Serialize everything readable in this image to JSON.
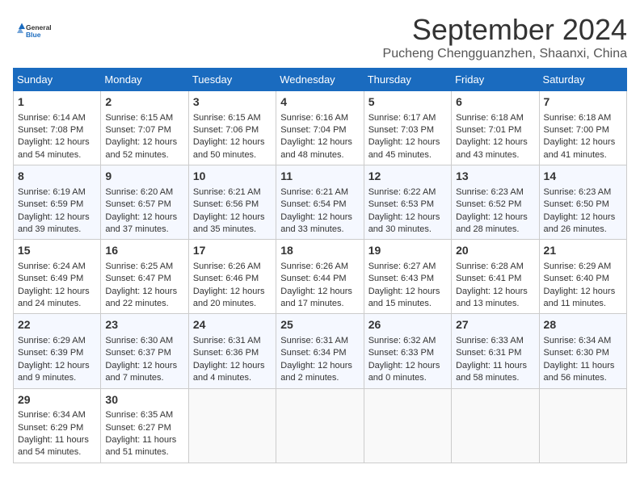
{
  "header": {
    "logo_general": "General",
    "logo_blue": "Blue",
    "month_title": "September 2024",
    "location": "Pucheng Chengguanzhen, Shaanxi, China"
  },
  "days_of_week": [
    "Sunday",
    "Monday",
    "Tuesday",
    "Wednesday",
    "Thursday",
    "Friday",
    "Saturday"
  ],
  "weeks": [
    [
      {
        "day": "1",
        "info": "Sunrise: 6:14 AM\nSunset: 7:08 PM\nDaylight: 12 hours\nand 54 minutes."
      },
      {
        "day": "2",
        "info": "Sunrise: 6:15 AM\nSunset: 7:07 PM\nDaylight: 12 hours\nand 52 minutes."
      },
      {
        "day": "3",
        "info": "Sunrise: 6:15 AM\nSunset: 7:06 PM\nDaylight: 12 hours\nand 50 minutes."
      },
      {
        "day": "4",
        "info": "Sunrise: 6:16 AM\nSunset: 7:04 PM\nDaylight: 12 hours\nand 48 minutes."
      },
      {
        "day": "5",
        "info": "Sunrise: 6:17 AM\nSunset: 7:03 PM\nDaylight: 12 hours\nand 45 minutes."
      },
      {
        "day": "6",
        "info": "Sunrise: 6:18 AM\nSunset: 7:01 PM\nDaylight: 12 hours\nand 43 minutes."
      },
      {
        "day": "7",
        "info": "Sunrise: 6:18 AM\nSunset: 7:00 PM\nDaylight: 12 hours\nand 41 minutes."
      }
    ],
    [
      {
        "day": "8",
        "info": "Sunrise: 6:19 AM\nSunset: 6:59 PM\nDaylight: 12 hours\nand 39 minutes."
      },
      {
        "day": "9",
        "info": "Sunrise: 6:20 AM\nSunset: 6:57 PM\nDaylight: 12 hours\nand 37 minutes."
      },
      {
        "day": "10",
        "info": "Sunrise: 6:21 AM\nSunset: 6:56 PM\nDaylight: 12 hours\nand 35 minutes."
      },
      {
        "day": "11",
        "info": "Sunrise: 6:21 AM\nSunset: 6:54 PM\nDaylight: 12 hours\nand 33 minutes."
      },
      {
        "day": "12",
        "info": "Sunrise: 6:22 AM\nSunset: 6:53 PM\nDaylight: 12 hours\nand 30 minutes."
      },
      {
        "day": "13",
        "info": "Sunrise: 6:23 AM\nSunset: 6:52 PM\nDaylight: 12 hours\nand 28 minutes."
      },
      {
        "day": "14",
        "info": "Sunrise: 6:23 AM\nSunset: 6:50 PM\nDaylight: 12 hours\nand 26 minutes."
      }
    ],
    [
      {
        "day": "15",
        "info": "Sunrise: 6:24 AM\nSunset: 6:49 PM\nDaylight: 12 hours\nand 24 minutes."
      },
      {
        "day": "16",
        "info": "Sunrise: 6:25 AM\nSunset: 6:47 PM\nDaylight: 12 hours\nand 22 minutes."
      },
      {
        "day": "17",
        "info": "Sunrise: 6:26 AM\nSunset: 6:46 PM\nDaylight: 12 hours\nand 20 minutes."
      },
      {
        "day": "18",
        "info": "Sunrise: 6:26 AM\nSunset: 6:44 PM\nDaylight: 12 hours\nand 17 minutes."
      },
      {
        "day": "19",
        "info": "Sunrise: 6:27 AM\nSunset: 6:43 PM\nDaylight: 12 hours\nand 15 minutes."
      },
      {
        "day": "20",
        "info": "Sunrise: 6:28 AM\nSunset: 6:41 PM\nDaylight: 12 hours\nand 13 minutes."
      },
      {
        "day": "21",
        "info": "Sunrise: 6:29 AM\nSunset: 6:40 PM\nDaylight: 12 hours\nand 11 minutes."
      }
    ],
    [
      {
        "day": "22",
        "info": "Sunrise: 6:29 AM\nSunset: 6:39 PM\nDaylight: 12 hours\nand 9 minutes."
      },
      {
        "day": "23",
        "info": "Sunrise: 6:30 AM\nSunset: 6:37 PM\nDaylight: 12 hours\nand 7 minutes."
      },
      {
        "day": "24",
        "info": "Sunrise: 6:31 AM\nSunset: 6:36 PM\nDaylight: 12 hours\nand 4 minutes."
      },
      {
        "day": "25",
        "info": "Sunrise: 6:31 AM\nSunset: 6:34 PM\nDaylight: 12 hours\nand 2 minutes."
      },
      {
        "day": "26",
        "info": "Sunrise: 6:32 AM\nSunset: 6:33 PM\nDaylight: 12 hours\nand 0 minutes."
      },
      {
        "day": "27",
        "info": "Sunrise: 6:33 AM\nSunset: 6:31 PM\nDaylight: 11 hours\nand 58 minutes."
      },
      {
        "day": "28",
        "info": "Sunrise: 6:34 AM\nSunset: 6:30 PM\nDaylight: 11 hours\nand 56 minutes."
      }
    ],
    [
      {
        "day": "29",
        "info": "Sunrise: 6:34 AM\nSunset: 6:29 PM\nDaylight: 11 hours\nand 54 minutes."
      },
      {
        "day": "30",
        "info": "Sunrise: 6:35 AM\nSunset: 6:27 PM\nDaylight: 11 hours\nand 51 minutes."
      },
      {
        "day": "",
        "info": ""
      },
      {
        "day": "",
        "info": ""
      },
      {
        "day": "",
        "info": ""
      },
      {
        "day": "",
        "info": ""
      },
      {
        "day": "",
        "info": ""
      }
    ]
  ]
}
